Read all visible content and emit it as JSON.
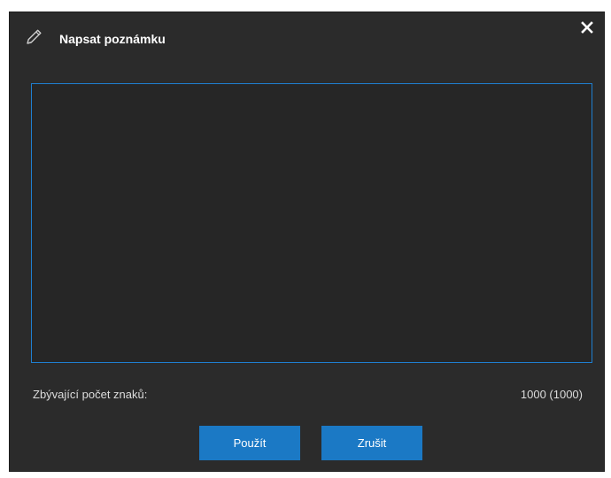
{
  "dialog": {
    "title": "Napsat poznámku",
    "title_icon": "pencil-icon",
    "close_icon": "close-icon",
    "note": {
      "value": "",
      "placeholder": ""
    },
    "remaining": {
      "label": "Zbývající počet znaků:",
      "value": "1000 (1000)"
    },
    "buttons": {
      "apply_label": "Použít",
      "cancel_label": "Zrušit"
    }
  },
  "colors": {
    "dialog_background": "#2b2b2b",
    "textarea_background": "#262626",
    "accent": "#1b79c5",
    "textarea_border": "#1f7fd0",
    "text": "#dcdcdc"
  }
}
